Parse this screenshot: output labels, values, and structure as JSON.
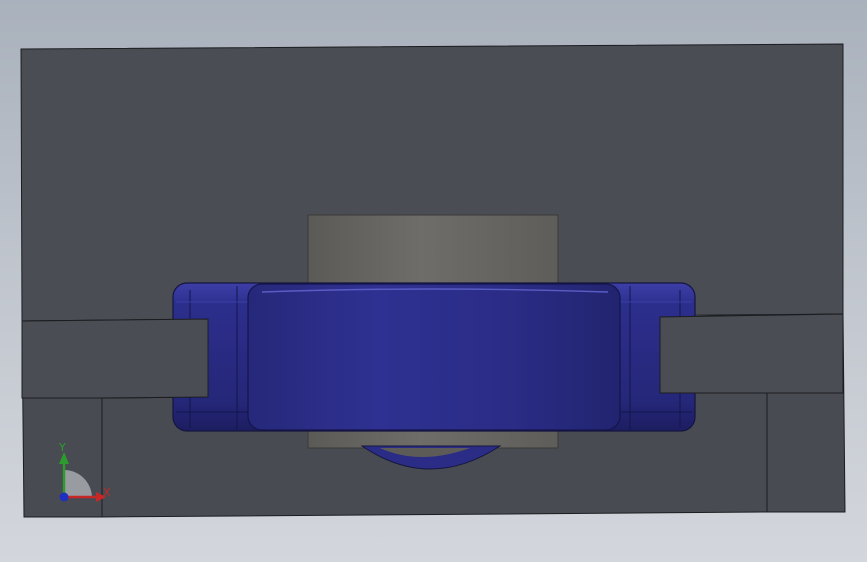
{
  "viewport": {
    "background_top": "#a9b1bc",
    "background_bottom": "#d3d6dc"
  },
  "model": {
    "colors": {
      "plate_face": "#4a4d54",
      "plate_edge": "#1c1d20",
      "shaft": "#6e6d69",
      "housing": "#2a2c86",
      "housing_highlight": "#4b4db8",
      "housing_shadow": "#191a55"
    }
  },
  "triad": {
    "x_label": "X",
    "y_label": "Y",
    "x_color": "#c62828",
    "y_color": "#2e9b2e",
    "z_color": "#1f2fbf"
  }
}
